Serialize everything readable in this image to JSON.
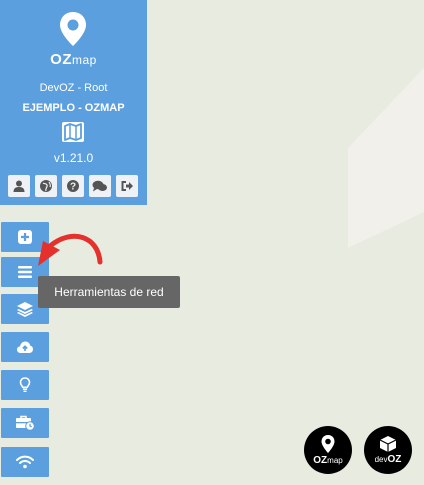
{
  "app": {
    "logo_main": "OZ",
    "logo_sub": "map",
    "user": "DevOZ - Root",
    "project": "EJEMPLO - OZMAP",
    "version": "v1.21.0"
  },
  "header_icons": [
    "user-icon",
    "globe-icon",
    "help-icon",
    "chat-icon",
    "logout-icon"
  ],
  "toolbar": {
    "buttons": [
      {
        "icon": "plus-square-icon"
      },
      {
        "icon": "hamburger-menu-icon"
      },
      {
        "icon": "layers-icon"
      },
      {
        "icon": "cloud-upload-icon"
      },
      {
        "icon": "lightbulb-icon"
      },
      {
        "icon": "toolbox-clock-icon"
      },
      {
        "icon": "wifi-icon"
      }
    ],
    "tooltip": "Herramientas de red"
  },
  "brands": {
    "ozmap_main": "OZ",
    "ozmap_sub": "map",
    "devoz_main": "dev",
    "devoz_sub": "OZ"
  },
  "colors": {
    "panel": "#5b9fde",
    "map_bg": "#e8ebdf",
    "tooltip": "#666666",
    "arrow": "#e4312b"
  }
}
